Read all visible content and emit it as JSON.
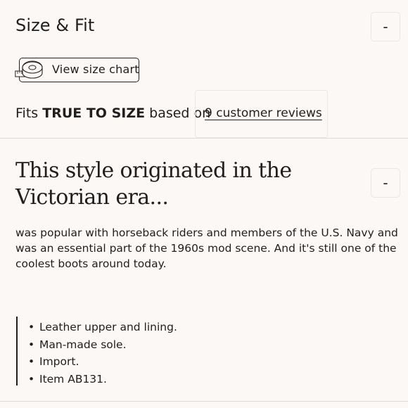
{
  "size_fit": {
    "title": "Size & Fit",
    "collapse_label": "-",
    "size_chart_label": "View size chart",
    "icon": "measuring-tape-icon",
    "fits_prefix": "Fits",
    "fits_value": "TRUE TO SIZE",
    "fits_suffix": "based on",
    "reviews_link": "9 customer reviews"
  },
  "style": {
    "heading": "This style originated in the Victorian era...",
    "collapse_label": "-",
    "description": "was popular with horseback riders and members of the U.S. Navy and was an essential part of the 1960s mod scene. And it's still one of the coolest boots around today.",
    "features": [
      "Leather upper and lining.",
      "Man-made sole.",
      "Import.",
      "Item AB131."
    ]
  }
}
